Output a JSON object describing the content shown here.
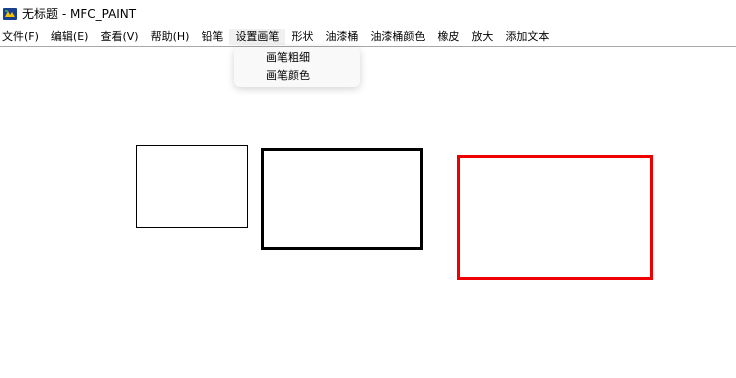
{
  "window": {
    "title": "无标题 - MFC_PAINT",
    "icon": "mfc-app-icon"
  },
  "menubar": {
    "items": [
      {
        "label": "文件(F)"
      },
      {
        "label": "编辑(E)"
      },
      {
        "label": "查看(V)"
      },
      {
        "label": "帮助(H)"
      },
      {
        "label": "铅笔"
      },
      {
        "label": "设置画笔"
      },
      {
        "label": "形状"
      },
      {
        "label": "油漆桶"
      },
      {
        "label": "油漆桶颜色"
      },
      {
        "label": "橡皮"
      },
      {
        "label": "放大"
      },
      {
        "label": "添加文本"
      }
    ],
    "active_index": 5
  },
  "dropdown": {
    "items": [
      {
        "label": "画笔粗细"
      },
      {
        "label": "画笔颜色"
      }
    ]
  },
  "canvas": {
    "shapes": [
      {
        "type": "rectangle",
        "stroke_color": "#000000"
      },
      {
        "type": "rectangle",
        "stroke_color": "#000000"
      },
      {
        "type": "rectangle",
        "stroke_color": "#ee0000"
      }
    ]
  }
}
